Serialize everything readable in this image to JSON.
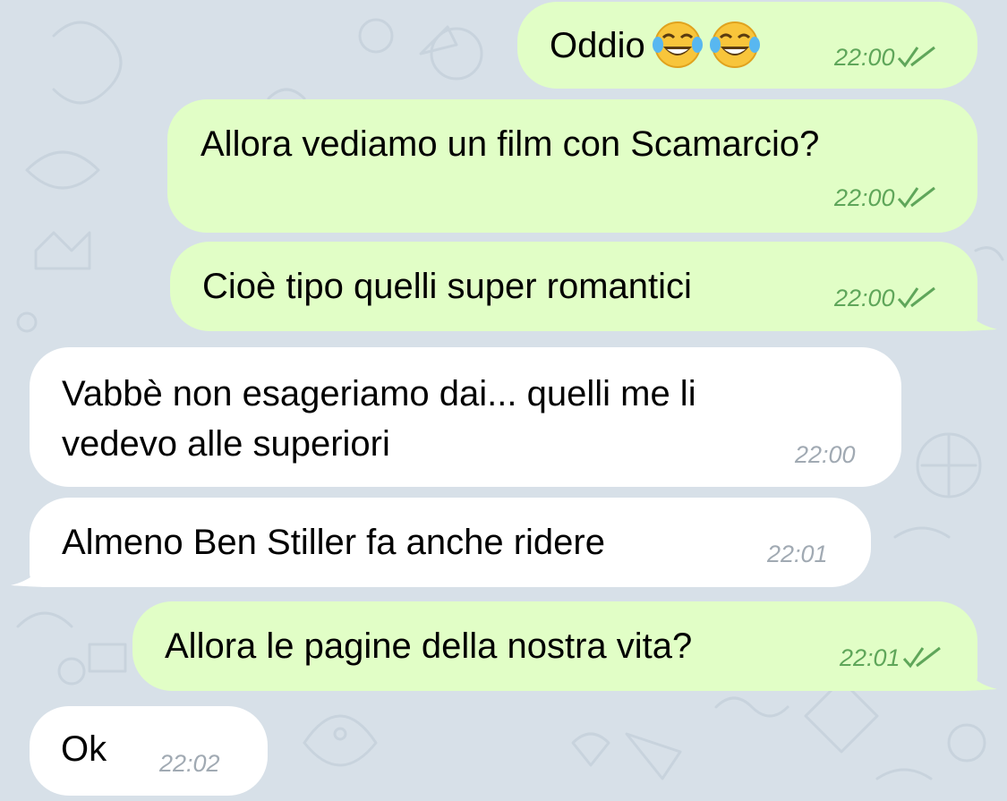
{
  "colors": {
    "background": "#d7e0e8",
    "outgoing_bubble": "#e1fec6",
    "incoming_bubble": "#ffffff",
    "outgoing_meta": "#5fa65a",
    "incoming_meta": "#a1aab3"
  },
  "messages": [
    {
      "direction": "outgoing",
      "text": "Oddio",
      "emoji": [
        "face-with-tears-of-joy-icon",
        "face-with-tears-of-joy-icon"
      ],
      "time": "22:00",
      "status": "read-double-check-icon"
    },
    {
      "direction": "outgoing",
      "text": "Allora vediamo un film con Scamarcio?",
      "time": "22:00",
      "status": "read-double-check-icon"
    },
    {
      "direction": "outgoing",
      "text": "Cioè tipo quelli super romantici",
      "time": "22:00",
      "status": "read-double-check-icon"
    },
    {
      "direction": "incoming",
      "text_line1": "Vabbè non esageriamo dai... quelli me li",
      "text_line2": "vedevo alle superiori",
      "time": "22:00"
    },
    {
      "direction": "incoming",
      "text": "Almeno Ben Stiller fa anche ridere",
      "time": "22:01"
    },
    {
      "direction": "outgoing",
      "text": "Allora le pagine della nostra vita?",
      "time": "22:01",
      "status": "read-double-check-icon"
    },
    {
      "direction": "incoming",
      "text": "Ok",
      "time": "22:02"
    }
  ]
}
